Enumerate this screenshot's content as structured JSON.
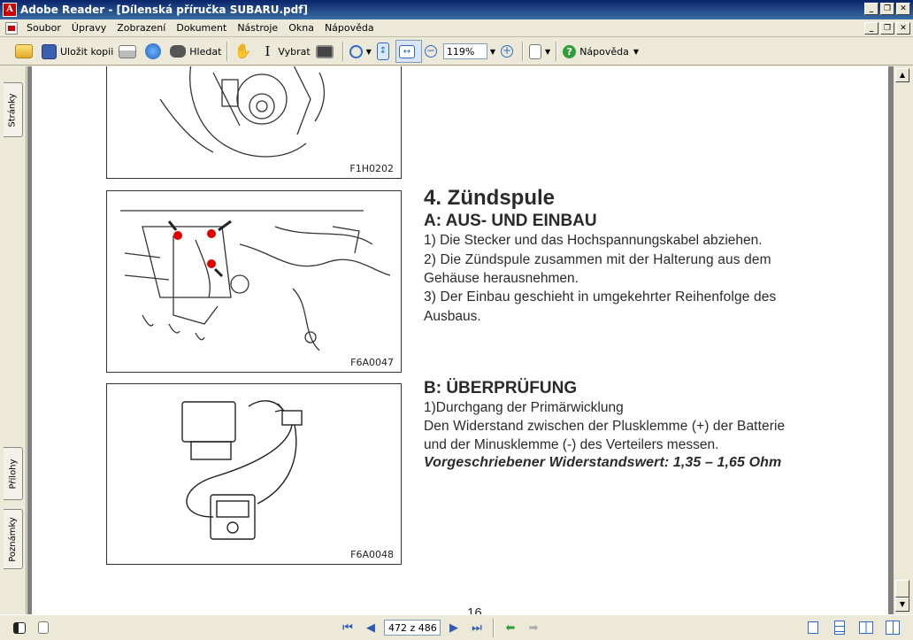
{
  "window": {
    "title": "Adobe Reader - [Dílenská příručka SUBARU.pdf]",
    "buttons": {
      "minimize": "_",
      "restore": "❐",
      "close": "✕"
    }
  },
  "menu": {
    "items": [
      "Soubor",
      "Úpravy",
      "Zobrazení",
      "Dokument",
      "Nástroje",
      "Okna",
      "Nápověda"
    ]
  },
  "toolbar": {
    "save_copy_label": "Uložit kopii",
    "search_label": "Hledat",
    "select_label": "Vybrat",
    "zoom_value": "119%",
    "help_label": "Nápověda"
  },
  "navpanel": {
    "tabs": {
      "pages": "Stránky",
      "attachments": "Přílohy",
      "comments": "Poznámky"
    }
  },
  "document": {
    "figures": {
      "fig1_label": "F1H0202",
      "fig2_label": "F6A0047",
      "fig3_label": "F6A0048"
    },
    "section_title": "4. Zündspule",
    "subsection_a": "A: AUS- UND EINBAU",
    "a_line1": "1) Die Stecker und das Hochspannungskabel abziehen.",
    "a_line2": "2) Die Zündspule zusammen mit der Halterung aus dem",
    "a_line3": "Gehäuse herausnehmen.",
    "a_line4": "3) Der Einbau geschieht in umgekehrter Reihenfolge des",
    "a_line5": "Ausbaus.",
    "subsection_b": "B: ÜBERPRÜFUNG",
    "b_line1": "1)Durchgang der Primärwicklung",
    "b_line2": "Den Widerstand zwischen der Plusklemme (+) der Batterie",
    "b_line3": "und der Minusklemme (-) des Verteilers messen.",
    "b_spec": "Vorgeschriebener Widerstandswert:  1,35 – 1,65 Ohm",
    "page_number": "16"
  },
  "statusbar": {
    "page_field": "472 z 486"
  },
  "colors": {
    "title_bar": "#0a246a",
    "accent_red": "#e00000",
    "link_blue": "#2e5ab3"
  }
}
